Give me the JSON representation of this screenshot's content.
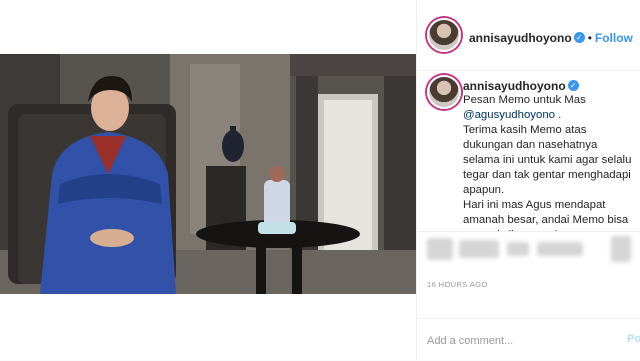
{
  "header": {
    "username": "annisayudhoyono",
    "verified_icon": "verified-badge-icon",
    "separator": "•",
    "follow_label": "Follow"
  },
  "caption": {
    "username": "annisayudhoyono",
    "line1": "Pesan Memo untuk Mas",
    "mention": "@agusyudhoyono",
    "mention_suffix": " .",
    "para1": "Terima kasih Memo atas dukungan dan nasehatnya selama ini untuk kami agar selalu tegar dan tak gentar menghadapi apapun.",
    "para2": "Hari ini mas Agus mendapat amanah besar, andai Memo bisa menyaksikannya dan memberikan nasehat seperti dulu. Semoga mas A..."
  },
  "footer": {
    "timestamp": "16 HOURS AGO"
  },
  "comment": {
    "placeholder": "Add a comment...",
    "post_label": "Post"
  },
  "colors": {
    "accent": "#3897f0",
    "border": "#efefef",
    "muted": "#999999"
  }
}
